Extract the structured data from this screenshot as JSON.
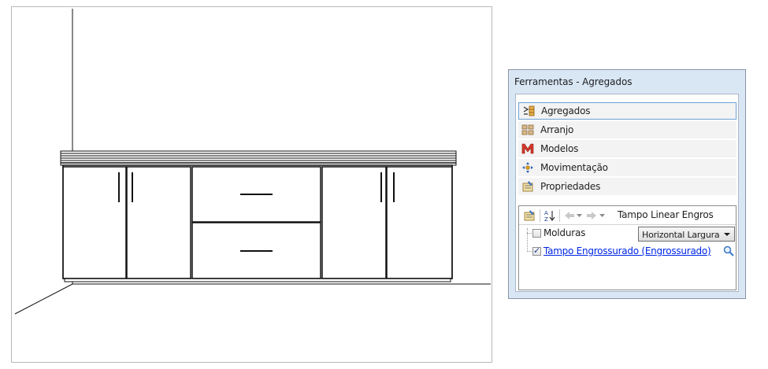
{
  "panel": {
    "title": "Ferramentas - Agregados",
    "tools": [
      {
        "label": "Agregados",
        "icon": "agregados-icon",
        "selected": true
      },
      {
        "label": "Arranjo",
        "icon": "arranjo-icon",
        "selected": false
      },
      {
        "label": "Modelos",
        "icon": "modelos-icon",
        "selected": false
      },
      {
        "label": "Movimentação",
        "icon": "movimentacao-icon",
        "selected": false
      },
      {
        "label": "Propriedades",
        "icon": "propriedades-icon",
        "selected": false
      }
    ],
    "properties": {
      "title": "Tampo Linear Engros",
      "items": [
        {
          "label": "Molduras",
          "checked": false,
          "dropdown_value": "Horizontal Largura"
        },
        {
          "label": "Tampo Engrossurado (Engrossurado)",
          "checked": true,
          "is_link": true
        }
      ]
    }
  },
  "colors": {
    "panel_background": "#d9e6f4",
    "link": "#0026e6",
    "selected_border": "#6ea3d6"
  }
}
